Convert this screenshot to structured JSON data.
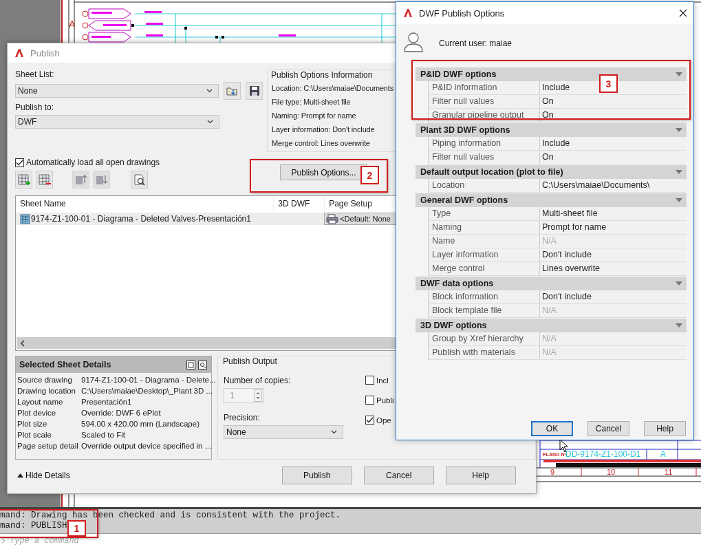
{
  "cad_drawing": {
    "grid_letter": "A",
    "title_block": {
      "plan_label": "PLANO Nº",
      "plan_number": "DD-9174-Z1-100-D1",
      "revision": "A"
    },
    "column_numbers": [
      "9",
      "10",
      "11"
    ]
  },
  "command_line": {
    "history": [
      "mand: Drawing has been checked and is consistent with the project.",
      "mand: PUBLISH"
    ],
    "placeholder": "Type a command"
  },
  "publish_dialog": {
    "title": "Publish",
    "sheet_list": {
      "label": "Sheet List:",
      "value": "None"
    },
    "publish_to": {
      "label": "Publish to:",
      "value": "DWF"
    },
    "options_info": {
      "title": "Publish Options Information",
      "lines": [
        "Location: C:\\Users\\maiae\\Documents",
        "File type: Multi-sheet file",
        "Naming: Prompt for name",
        "Layer information: Don't include",
        "Merge control: Lines overwrite"
      ]
    },
    "publish_options_button": "Publish Options...",
    "auto_load": {
      "label": "Automatically load all open drawings",
      "checked": true
    },
    "table": {
      "columns": [
        "Sheet Name",
        "3D DWF",
        "Page Setup"
      ],
      "rows": [
        {
          "sheet_name": "9174-Z1-100-01 - Diagrama - Deleted Valves-Presentación1",
          "page_setup": "<Default: None",
          "selected": true
        }
      ]
    },
    "details": {
      "title": "Selected Sheet Details",
      "rows": [
        {
          "label": "Source drawing",
          "value": "9174-Z1-100-01 - Diagrama - Delete..."
        },
        {
          "label": "Drawing location",
          "value": "C:\\Users\\maiae\\Desktop\\_Plant 3D ..."
        },
        {
          "label": "Layout name",
          "value": "Presentación1"
        },
        {
          "label": "Plot device",
          "value": "Override: DWF 6 ePlot"
        },
        {
          "label": "Plot size",
          "value": "594.00 x 420.00 mm (Landscape)"
        },
        {
          "label": "Plot scale",
          "value": "Scaled to Fit"
        },
        {
          "label": "Page setup detail",
          "value": "Override output device specified in ..."
        }
      ]
    },
    "publish_output": {
      "title": "Publish Output",
      "copies": {
        "label": "Number of copies:",
        "value": "1",
        "disabled": true
      },
      "precision": {
        "label": "Precision:",
        "value": "None"
      },
      "checkboxes": [
        {
          "label": "Incl",
          "checked": false
        },
        {
          "label": "Publi",
          "checked": false
        },
        {
          "label": "Ope",
          "checked": true
        }
      ]
    },
    "hide_details": "Hide Details",
    "buttons": [
      "Publish",
      "Cancel",
      "Help"
    ]
  },
  "dwf_dialog": {
    "title": "DWF Publish Options",
    "current_user": "Current user: maiae",
    "sections": [
      {
        "title": "P&ID DWF options",
        "expanded": true,
        "rows": [
          {
            "label": "P&ID information",
            "value": "Include",
            "disabled": false
          },
          {
            "label": "Filter null values",
            "value": "On",
            "disabled": false
          },
          {
            "label": "Granular pipeline output",
            "value": "On",
            "disabled": false
          }
        ]
      },
      {
        "title": "Plant 3D DWF options",
        "expanded": true,
        "rows": [
          {
            "label": "Piping information",
            "value": "Include",
            "disabled": false
          },
          {
            "label": "Filter null values",
            "value": "On",
            "disabled": false
          }
        ]
      },
      {
        "title": "Default output location (plot to file)",
        "expanded": true,
        "rows": [
          {
            "label": "Location",
            "value": "C:\\Users\\maiae\\Documents\\",
            "disabled": false
          }
        ]
      },
      {
        "title": "General DWF options",
        "expanded": true,
        "rows": [
          {
            "label": "Type",
            "value": "Multi-sheet file",
            "disabled": false
          },
          {
            "label": "Naming",
            "value": "Prompt for name",
            "disabled": false
          },
          {
            "label": "Name",
            "value": "N/A",
            "disabled": true
          },
          {
            "label": "Layer information",
            "value": "Don't include",
            "disabled": false
          },
          {
            "label": "Merge control",
            "value": "Lines overwrite",
            "disabled": false
          }
        ]
      },
      {
        "title": "DWF data options",
        "expanded": true,
        "rows": [
          {
            "label": "Block information",
            "value": "Don't include",
            "disabled": false
          },
          {
            "label": "Block template file",
            "value": "N/A",
            "disabled": true
          }
        ]
      },
      {
        "title": "3D DWF options",
        "expanded": true,
        "rows": [
          {
            "label": "Group by Xref hierarchy",
            "value": "N/A",
            "disabled": true
          },
          {
            "label": "Publish with materials",
            "value": "N/A",
            "disabled": true
          }
        ]
      }
    ],
    "buttons": [
      {
        "label": "OK",
        "default": true
      },
      {
        "label": "Cancel",
        "default": false
      },
      {
        "label": "Help",
        "default": false
      }
    ]
  },
  "annotations": [
    {
      "number": "1"
    },
    {
      "number": "2"
    },
    {
      "number": "3"
    }
  ]
}
